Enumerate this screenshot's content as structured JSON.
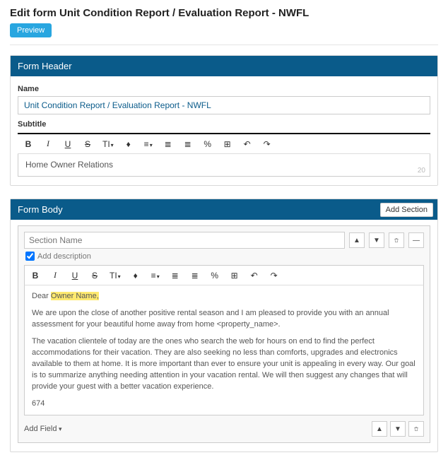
{
  "page_title": "Edit form Unit Condition Report / Evaluation Report - NWFL",
  "preview_button": "Preview",
  "header_panel": {
    "title": "Form Header",
    "name_label": "Name",
    "name_value": "Unit Condition Report / Evaluation Report - NWFL",
    "subtitle_label": "Subtitle",
    "subtitle_value": "Home Owner Relations",
    "subtitle_count": "20",
    "toolbar": {
      "bold": "B",
      "italic": "I",
      "underline": "U",
      "strike": "S",
      "size": "TI",
      "color": "♦",
      "align": "≡",
      "ol": "≣",
      "ul": "≣",
      "link": "%",
      "table": "⊞",
      "undo": "↶",
      "redo": "↷"
    }
  },
  "body_panel": {
    "title": "Form Body",
    "add_section": "Add Section",
    "section": {
      "name_placeholder": "Section Name",
      "add_desc_label": "Add description",
      "dear": "Dear ",
      "owner_name": "Owner Name,",
      "p1a": "We are upon the close of another positive rental season and I am pleased to provide you with an annual assessment for your beautiful home away from home ",
      "p1b": "<property_name>.",
      "p2": "The vacation clientele of today are the ones who search the web for hours on end to find the perfect accommodations for their vacation.  They are also seeking no less than comforts, upgrades and electronics available to them at home. It is more important than ever to ensure your unit is appealing in every way.   Our goal is to summarize anything needing attention in your vacation rental.   We will then suggest any changes that will provide your guest with a better vacation experience.",
      "count": "674",
      "add_field": "Add Field",
      "toolbar": {
        "bold": "B",
        "italic": "I",
        "underline": "U",
        "strike": "S",
        "size": "TI",
        "color": "♦",
        "align": "≡",
        "ol": "≣",
        "ul": "≣",
        "link": "%",
        "table": "⊞",
        "undo": "↶",
        "redo": "↷"
      }
    }
  }
}
